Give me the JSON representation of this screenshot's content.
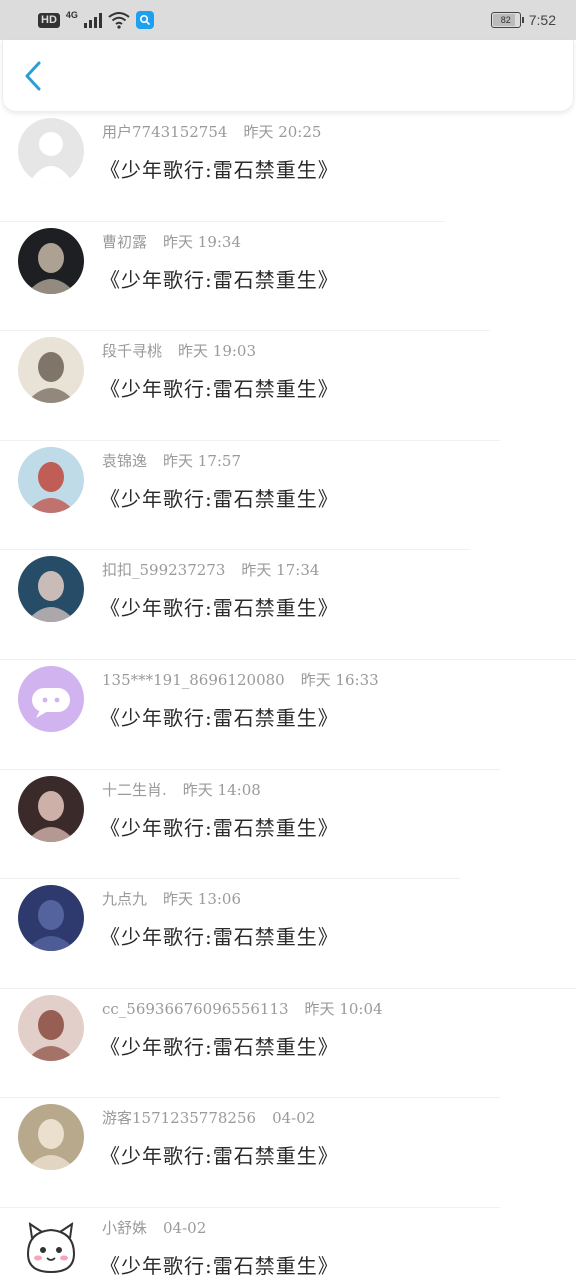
{
  "status_bar": {
    "hd": "HD",
    "network": "4G",
    "battery": "82",
    "time": "7:52"
  },
  "nav": {
    "back_icon": "chevron-left-icon",
    "accent": "#2a9fd6"
  },
  "comments": [
    {
      "user": "用户7743152754",
      "time": "昨天 20:25",
      "text": "《少年歌行:雷石禁重生》",
      "avatar": "default-avatar",
      "avatar_colors": [
        "#e6e6e6",
        "#ffffff"
      ]
    },
    {
      "user": "曹初露",
      "time": "昨天 19:34",
      "text": "《少年歌行:雷石禁重生》",
      "avatar": "photo-avatar",
      "avatar_colors": [
        "#1d1f22",
        "#c7b9a8"
      ]
    },
    {
      "user": "段千寻桃",
      "time": "昨天 19:03",
      "text": "《少年歌行:雷石禁重生》",
      "avatar": "photo-avatar",
      "avatar_colors": [
        "#e9e2d6",
        "#6d6256"
      ]
    },
    {
      "user": "袁锦逸",
      "time": "昨天 17:57",
      "text": "《少年歌行:雷石禁重生》",
      "avatar": "photo-avatar",
      "avatar_colors": [
        "#bfdbe8",
        "#c0463c"
      ]
    },
    {
      "user": "扣扣_599237273",
      "time": "昨天 17:34",
      "text": "《少年歌行:雷石禁重生》",
      "avatar": "photo-avatar",
      "avatar_colors": [
        "#274c68",
        "#e6cfc7"
      ]
    },
    {
      "user": "135***191_8696120080",
      "time": "昨天 16:33",
      "text": "《少年歌行:雷石禁重生》",
      "avatar": "chat-bubble-avatar",
      "avatar_colors": [
        "#d1b3f0",
        "#ffffff"
      ]
    },
    {
      "user": "十二生肖.",
      "time": "昨天 14:08",
      "text": "《少年歌行:雷石禁重生》",
      "avatar": "photo-avatar",
      "avatar_colors": [
        "#3a2a2a",
        "#e8c8bd"
      ]
    },
    {
      "user": "九点九",
      "time": "昨天 13:06",
      "text": "《少年歌行:雷石禁重生》",
      "avatar": "photo-avatar",
      "avatar_colors": [
        "#2e3a6e",
        "#5b6aa6"
      ]
    },
    {
      "user": "cc_56936676096556113",
      "time": "昨天 10:04",
      "text": "《少年歌行:雷石禁重生》",
      "avatar": "photo-avatar",
      "avatar_colors": [
        "#e3cfc9",
        "#8a4a3e"
      ]
    },
    {
      "user": "游客1571235778256",
      "time": "04-02",
      "text": "《少年歌行:雷石禁重生》",
      "avatar": "photo-avatar",
      "avatar_colors": [
        "#b8a98c",
        "#f3ead8"
      ]
    },
    {
      "user": "小舒姝",
      "time": "04-02",
      "text": "《少年歌行:雷石禁重生》",
      "avatar": "cat-cartoon-avatar",
      "avatar_colors": [
        "#ffffff",
        "#333333"
      ]
    }
  ]
}
